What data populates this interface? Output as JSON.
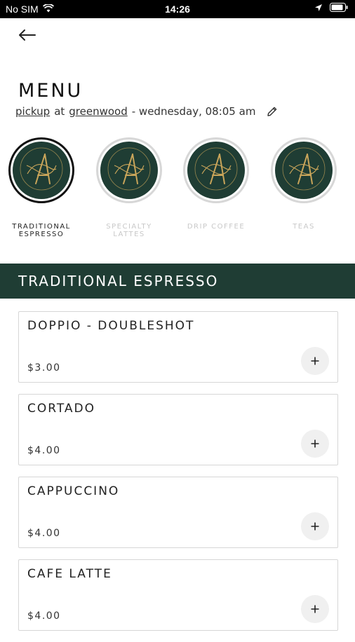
{
  "status_bar": {
    "carrier": "No SIM",
    "time": "14:26",
    "icons": [
      "wifi-icon",
      "location-icon",
      "battery-icon"
    ]
  },
  "header": {
    "back_icon": "arrow-left-icon",
    "title": "MENU"
  },
  "order": {
    "mode": "pickup",
    "at": "at",
    "location": "greenwood",
    "when": "- wednesday, 08:05 am",
    "edit_icon": "pencil-icon"
  },
  "categories": [
    {
      "label": "TRADITIONAL ESPRESSO",
      "active": true
    },
    {
      "label": "SPECIALTY LATTES",
      "active": false
    },
    {
      "label": "DRIP COFFEE",
      "active": false
    },
    {
      "label": "TEAS",
      "active": false
    }
  ],
  "section": {
    "title": "TRADITIONAL ESPRESSO"
  },
  "items": [
    {
      "name": "DOPPIO - DOUBLESHOT",
      "price": "$3.00"
    },
    {
      "name": "CORTADO",
      "price": "$4.00"
    },
    {
      "name": "CAPPUCCINO",
      "price": "$4.00"
    },
    {
      "name": "CAFE LATTE",
      "price": "$4.00"
    }
  ],
  "colors": {
    "brand_green": "#1f3d34",
    "gold": "#c9a55a"
  }
}
